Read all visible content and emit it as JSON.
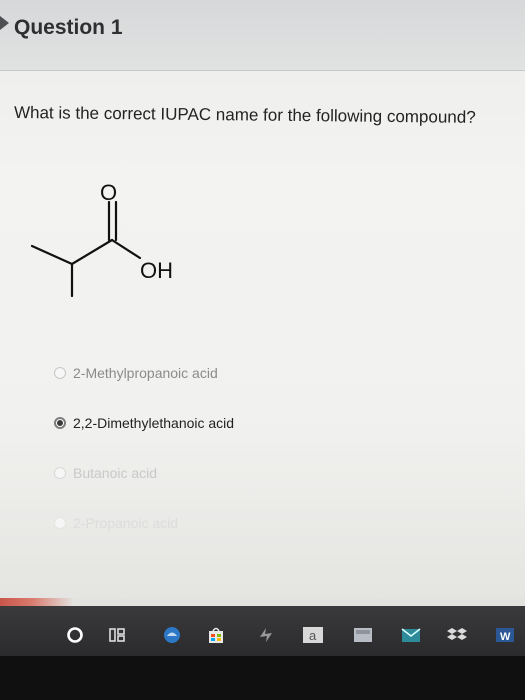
{
  "header": {
    "title": "Question 1"
  },
  "question": {
    "text": "What is the correct IUPAC name for the following compound?",
    "structure_labels": {
      "oxygen": "O",
      "hydroxyl": "OH"
    }
  },
  "choices": [
    {
      "label": "2-Methylpropanoic acid",
      "selected": false
    },
    {
      "label": "2,2-Dimethylethanoic acid",
      "selected": true
    },
    {
      "label": "Butanoic acid",
      "selected": false
    },
    {
      "label": "2-Propanoic acid",
      "selected": false
    }
  ],
  "taskbar": {
    "icons": [
      "cortana-circle-icon",
      "task-view-icon",
      "edge-browser-icon",
      "store-icon",
      "dollar-app-icon",
      "amazon-icon",
      "app-icon",
      "mail-icon",
      "dropbox-icon",
      "word-icon"
    ],
    "amazon_glyph": "a"
  },
  "colors": {
    "selected_text": "#222222",
    "header_bg": "#d6d8d9",
    "taskbar_bg": "#2f2f31"
  }
}
